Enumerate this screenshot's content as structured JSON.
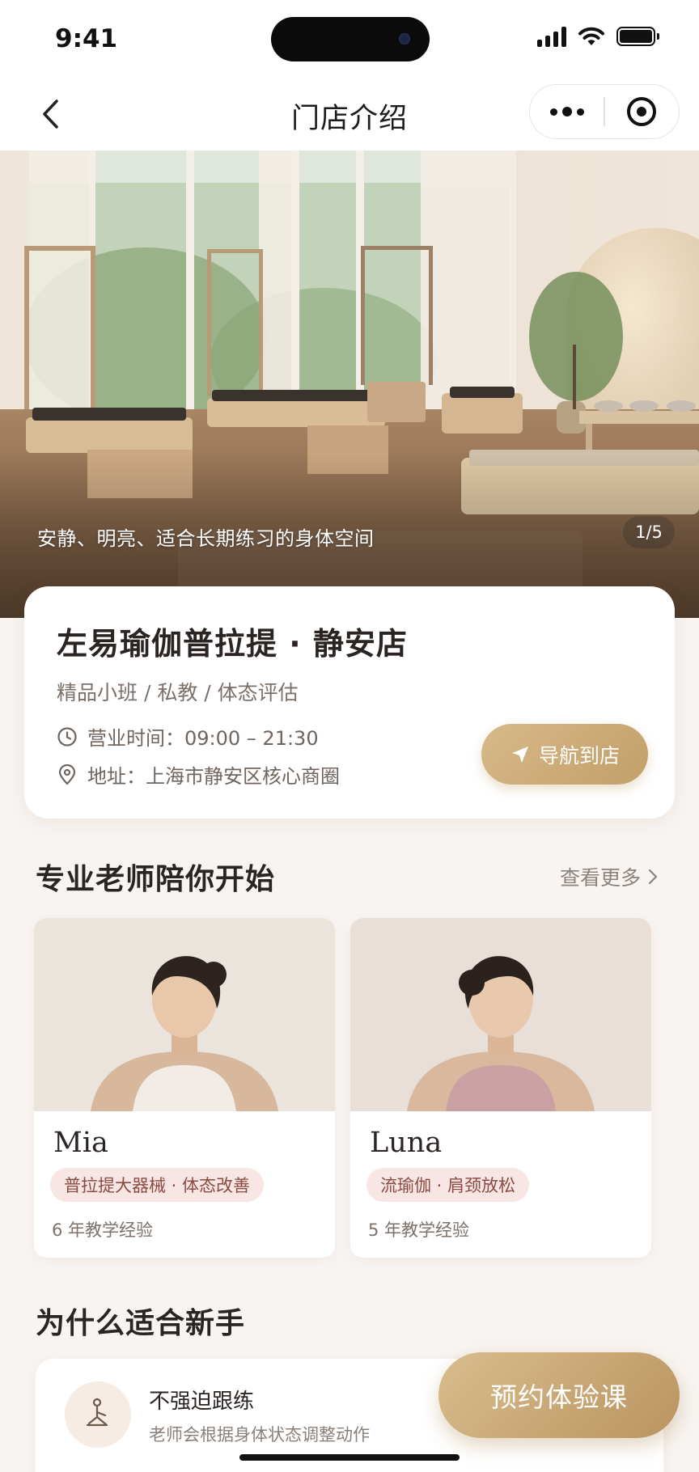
{
  "status_bar": {
    "time": "9:41"
  },
  "nav": {
    "title": "门店介绍",
    "back_icon": "chevron-left-icon",
    "more_icon": "more-dots-icon",
    "close_icon": "target-circle-icon"
  },
  "hero": {
    "caption": "安静、明亮、适合长期练习的身体空间",
    "counter": "1/5"
  },
  "store": {
    "name": "左易瑜伽普拉提 · 静安店",
    "tags": "精品小班 / 私教 / 体态评估",
    "hours": "营业时间：09:00 – 21:30",
    "address": "地址：上海市静安区核心商圈",
    "navigate_label": "导航到店",
    "accent_color": "#c8a672"
  },
  "teachers_section": {
    "title": "专业老师陪你开始",
    "see_more": "查看更多",
    "teachers": [
      {
        "name": "Mia",
        "tag": "普拉提大器械 · 体态改善",
        "experience": "6 年教学经验"
      },
      {
        "name": "Luna",
        "tag": "流瑜伽 · 肩颈放松",
        "experience": "5 年教学经验"
      }
    ]
  },
  "why_section": {
    "title": "为什么适合新手",
    "items": [
      {
        "title": "不强迫跟练",
        "desc": "老师会根据身体状态调整动作",
        "icon": "yoga-pose-icon"
      }
    ]
  },
  "cta": {
    "label": "预约体验课"
  }
}
